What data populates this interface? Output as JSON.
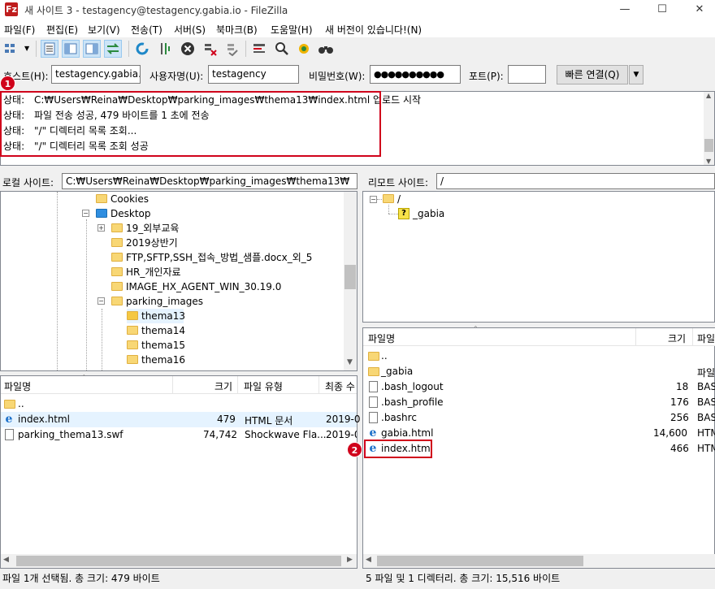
{
  "window": {
    "title": "새 사이트 3 - testagency@testagency.gabia.io - FileZilla",
    "app_icon": "Fz",
    "minimize": "—",
    "maximize": "☐",
    "close": "✕"
  },
  "menu": [
    "파일(F)",
    "편집(E)",
    "보기(V)",
    "전송(T)",
    "서버(S)",
    "북마크(B)",
    "도움말(H)",
    "새 버전이 있습니다!(N)"
  ],
  "toolbar": {
    "icons": [
      "site-manager-icon",
      "toggle-log-icon",
      "toggle-local-tree-icon",
      "toggle-remote-tree-icon",
      "toggle-queue-icon",
      "refresh-icon",
      "process-queue-icon",
      "cancel-icon",
      "disconnect-icon",
      "reconnect-icon",
      "filter-icon",
      "search-icon",
      "compare-icon",
      "binoculars-icon"
    ]
  },
  "quickconnect": {
    "host_label": "호스트(H):",
    "host_value": "testagency.gabia.io",
    "user_label": "사용자명(U):",
    "user_value": "testagency",
    "pass_label": "비밀번호(W):",
    "pass_value": "●●●●●●●●●●",
    "port_label": "포트(P):",
    "port_value": "",
    "connect_label": "빠른 연결(Q)",
    "dropdown": "▼"
  },
  "log": [
    {
      "label": "상태:",
      "text": "C:₩Users₩Reina₩Desktop₩parking_images₩thema13₩index.html 업로드 시작"
    },
    {
      "label": "상태:",
      "text": "파일 전송 성공, 479 바이트를 1 초에 전송"
    },
    {
      "label": "상태:",
      "text": "\"/\" 디렉터리 목록 조회..."
    },
    {
      "label": "상태:",
      "text": "\"/\" 디렉터리 목록 조회 성공"
    }
  ],
  "badges": {
    "one": "1",
    "two": "2"
  },
  "local": {
    "site_label": "로컬 사이트:",
    "path": "C:₩Users₩Reina₩Desktop₩parking_images₩thema13₩",
    "tree": [
      "Cookies",
      "Desktop",
      "19_외부교육",
      "2019상반기",
      "FTP,SFTP,SSH_접속_방법_샘플.docx_외_5",
      "HR_개인자료",
      "IMAGE_HX_AGENT_WIN_30.19.0",
      "parking_images",
      "thema13",
      "thema14",
      "thema15",
      "thema16"
    ],
    "columns": {
      "name": "파일명",
      "size": "크기",
      "type": "파일 유형",
      "modified": "최종 수"
    },
    "files": [
      {
        "name": "..",
        "size": "",
        "type": "",
        "modified": ""
      },
      {
        "name": "index.html",
        "size": "479",
        "type": "HTML 문서",
        "modified": "2019-0"
      },
      {
        "name": "parking_thema13.swf",
        "size": "74,742",
        "type": "Shockwave Fla...",
        "modified": "2019-0"
      }
    ],
    "status": "파일 1개 선택됨. 총 크기: 479 바이트"
  },
  "remote": {
    "site_label": "리모트 사이트:",
    "path": "/",
    "tree": [
      "/",
      "_gabia"
    ],
    "columns": {
      "name": "파일명",
      "size": "크기",
      "type": "파일"
    },
    "files": [
      {
        "name": "..",
        "size": "",
        "type": ""
      },
      {
        "name": "_gabia",
        "size": "",
        "type": "파일"
      },
      {
        "name": ".bash_logout",
        "size": "18",
        "type": "BAS"
      },
      {
        "name": ".bash_profile",
        "size": "176",
        "type": "BAS"
      },
      {
        "name": ".bashrc",
        "size": "256",
        "type": "BAS"
      },
      {
        "name": "gabia.html",
        "size": "14,600",
        "type": "HTM"
      },
      {
        "name": "index.html",
        "size": "466",
        "type": "HTM"
      }
    ],
    "status": "5 파일 및 1 디렉터리. 총 크기: 15,516 바이트"
  },
  "colors": {
    "accent_red": "#d0021b",
    "selection": "#e5f3ff",
    "folder": "#f8d775"
  }
}
